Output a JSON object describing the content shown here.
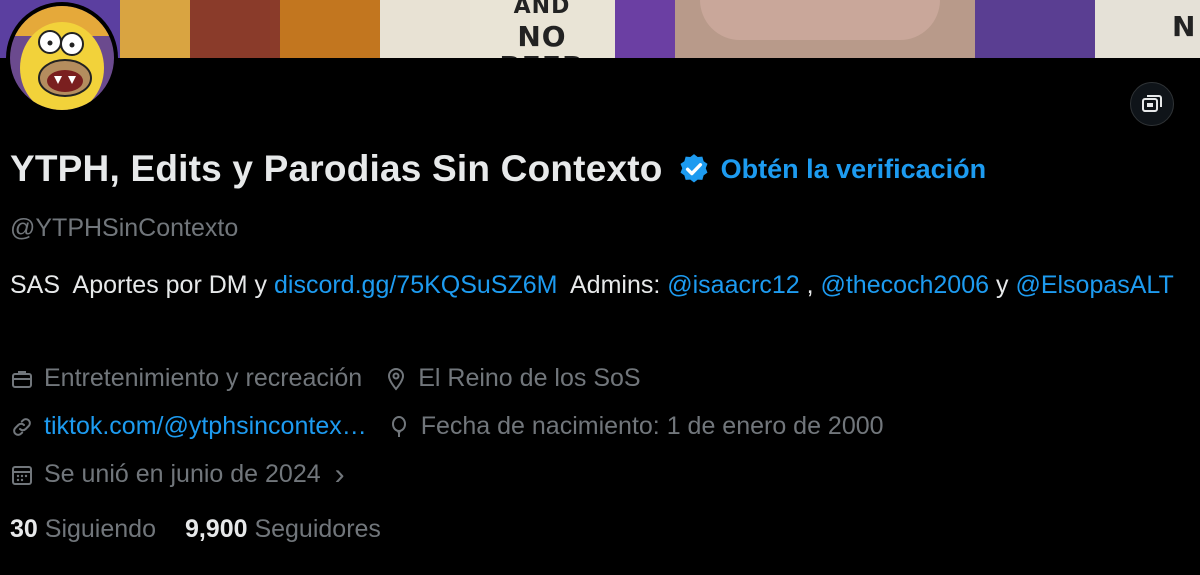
{
  "banner": {
    "sign_text_top": "AND",
    "sign_text_bottom": "NO BEER",
    "edge_letter": "N"
  },
  "profile": {
    "display_name": "YTPH, Edits y Parodias Sin Contexto",
    "get_verified_label": "Obtén la verificación",
    "handle": "@YTPHSinContexto"
  },
  "bio": {
    "text_1": "SAS  Aportes por DM y ",
    "link_discord": "discord.gg/75KQSuSZ6M",
    "text_2": "  Admins: ",
    "mention_1": "@isaacrc12",
    "text_3": " , ",
    "mention_2": "@thecoch2006",
    "text_4": " y ",
    "mention_3": "@ElsopasALT"
  },
  "meta": {
    "category": "Entretenimiento y recreación",
    "location": "El Reino de los SoS",
    "website": "tiktok.com/@ytphsincontex…",
    "birthday": "Fecha de nacimiento: 1 de enero de 2000",
    "joined": "Se unió en junio de 2024",
    "joined_chevron": "›"
  },
  "stats": {
    "following_count": "30",
    "following_label": "Siguiendo",
    "followers_count": "9,900",
    "followers_label": "Seguidores"
  },
  "colors": {
    "background": "#000000",
    "accent": "#1d9bf0",
    "secondary_text": "#71767b",
    "primary_text": "#e7e9ea"
  },
  "icons": [
    "briefcase-icon",
    "location-pin-icon",
    "link-icon",
    "balloon-icon",
    "calendar-icon",
    "media-viewer-icon",
    "verified-badge-icon"
  ]
}
